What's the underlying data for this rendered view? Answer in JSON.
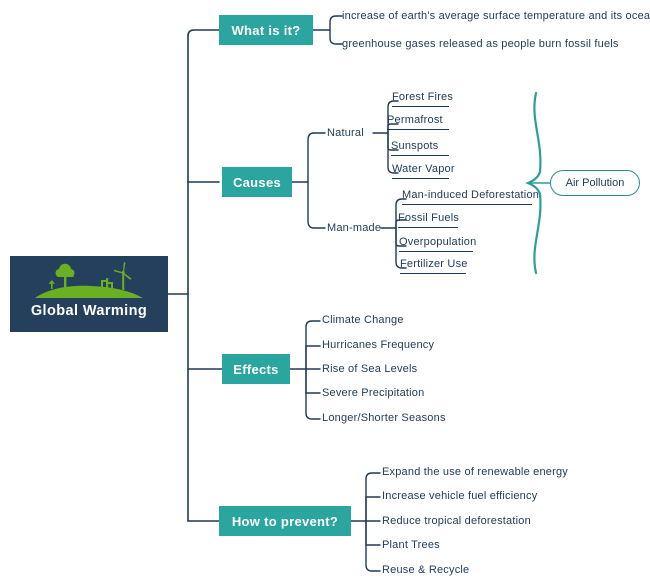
{
  "map": {
    "title": "Global Warming",
    "colors": {
      "root_bg": "#24405d",
      "topic_bg": "#2ba5a0",
      "line": "#1f3a57",
      "brace": "#2b9e99",
      "pill_border": "#2b8f8c",
      "art_green": "#6ab023"
    }
  },
  "root": {
    "label": "Global Warming",
    "icon": "earth-landscape-icon"
  },
  "topics": [
    {
      "id": "what-is-it",
      "label": "What is it?",
      "items": [
        {
          "text": "increase of earth's average surface temperature and its oceans",
          "underline": false
        },
        {
          "text": "greenhouse gases released as people burn fossil fuels",
          "underline": false
        }
      ]
    },
    {
      "id": "causes",
      "label": "Causes",
      "groups": [
        {
          "label": "Natural",
          "items": [
            {
              "text": "Forest Fires",
              "underline": true
            },
            {
              "text": "Permafrost",
              "underline": true
            },
            {
              "text": "Sunspots",
              "underline": true
            },
            {
              "text": "Water Vapor",
              "underline": true
            }
          ]
        },
        {
          "label": "Man-made",
          "items": [
            {
              "text": "Man-induced Deforestation",
              "underline": true
            },
            {
              "text": "Fossil Fuels",
              "underline": true
            },
            {
              "text": "Overpopulation",
              "underline": true
            },
            {
              "text": "Fertilizer Use",
              "underline": true
            }
          ]
        }
      ],
      "callout": {
        "label": "Air Pollution",
        "brace": "right-curly-brace"
      }
    },
    {
      "id": "effects",
      "label": "Effects",
      "items": [
        {
          "text": "Climate Change",
          "underline": false
        },
        {
          "text": "Hurricanes Frequency",
          "underline": false
        },
        {
          "text": "Rise of Sea Levels",
          "underline": false
        },
        {
          "text": "Severe Precipitation",
          "underline": false
        },
        {
          "text": "Longer/Shorter Seasons",
          "underline": false
        }
      ]
    },
    {
      "id": "how-to-prevent",
      "label": "How to prevent?",
      "items": [
        {
          "text": "Expand the use of renewable energy",
          "underline": false
        },
        {
          "text": "Increase vehicle fuel efficiency",
          "underline": false
        },
        {
          "text": "Reduce tropical deforestation",
          "underline": false
        },
        {
          "text": "Plant Trees",
          "underline": false
        },
        {
          "text": "Reuse & Recycle",
          "underline": false
        }
      ]
    }
  ]
}
